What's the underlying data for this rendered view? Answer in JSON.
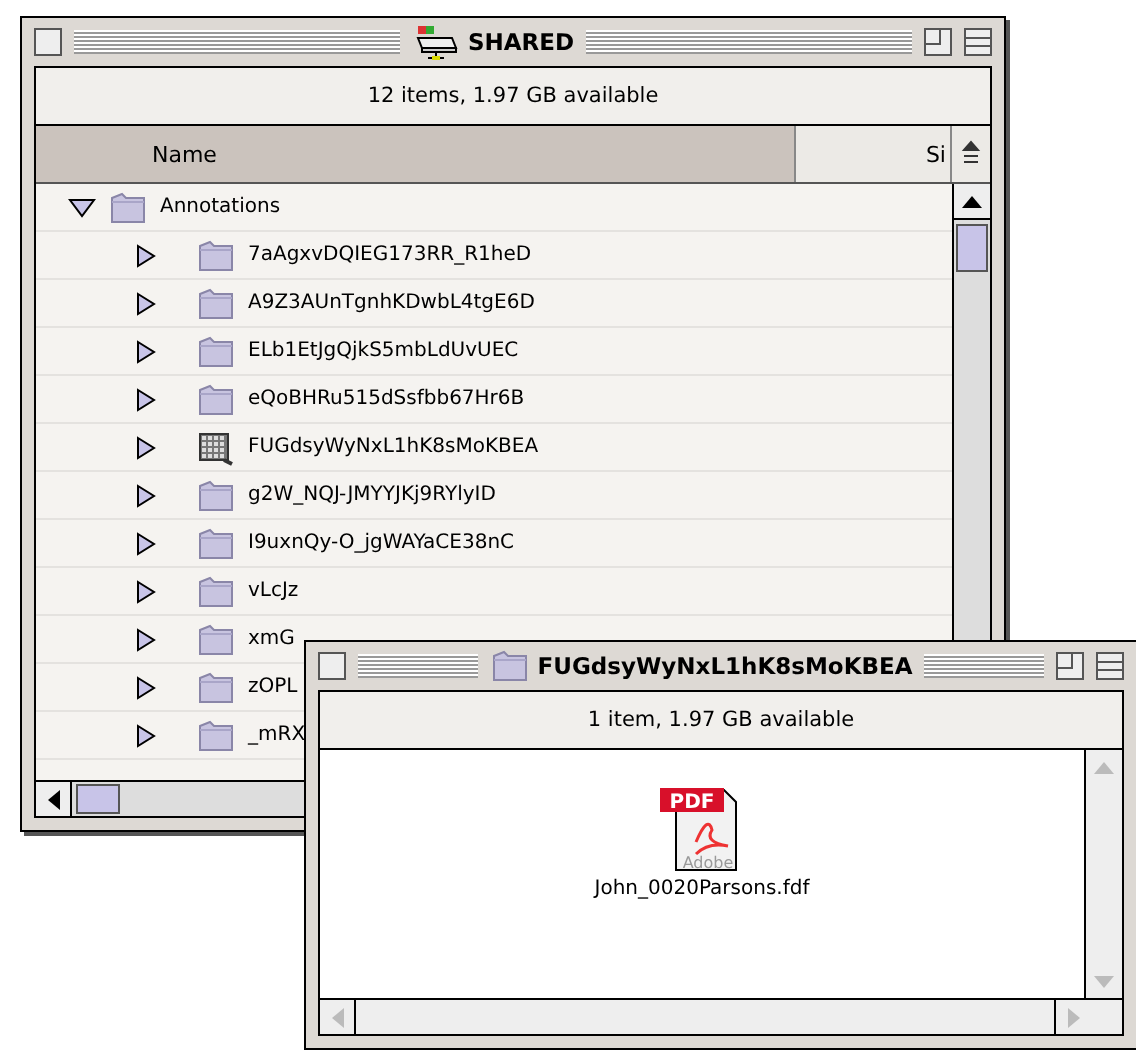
{
  "back_window": {
    "title": "SHARED",
    "info": "12 items, 1.97 GB available",
    "columns": [
      {
        "label": "Name",
        "selected": true
      },
      {
        "label": "Si",
        "selected": false
      }
    ],
    "tree": [
      {
        "name": "Annotations",
        "kind": "folder",
        "expanded": true,
        "children": [
          {
            "name": "7aAgxvDQIEG173RR_R1heD",
            "kind": "folder",
            "expanded": false
          },
          {
            "name": "A9Z3AUnTgnhKDwbL4tgE6D",
            "kind": "folder",
            "expanded": false
          },
          {
            "name": "ELb1EtJgQjkS5mbLdUvUEC",
            "kind": "folder",
            "expanded": false
          },
          {
            "name": "eQoBHRu515dSsfbb67Hr6B",
            "kind": "folder",
            "expanded": false
          },
          {
            "name": "FUGdsyWyNxL1hK8sMoKBEA",
            "kind": "grid_folder",
            "expanded": false
          },
          {
            "name": "g2W_NQJ-JMYYJKj9RYlyID",
            "kind": "folder",
            "expanded": false
          },
          {
            "name": "I9uxnQy-O_jgWAYaCE38nC",
            "kind": "folder",
            "expanded": false
          },
          {
            "name": "vLcJz",
            "kind": "folder",
            "expanded": false
          },
          {
            "name": "xmG",
            "kind": "folder",
            "expanded": false
          },
          {
            "name": "zOPL",
            "kind": "folder",
            "expanded": false
          },
          {
            "name": "_mRX",
            "kind": "folder",
            "expanded": false
          }
        ]
      }
    ]
  },
  "front_window": {
    "title": "FUGdsyWyNxL1hK8sMoKBEA",
    "info": "1 item, 1.97 GB available",
    "files": [
      {
        "name": "John_0020Parsons.fdf",
        "badge": "PDF",
        "caption": "Adobe"
      }
    ]
  }
}
